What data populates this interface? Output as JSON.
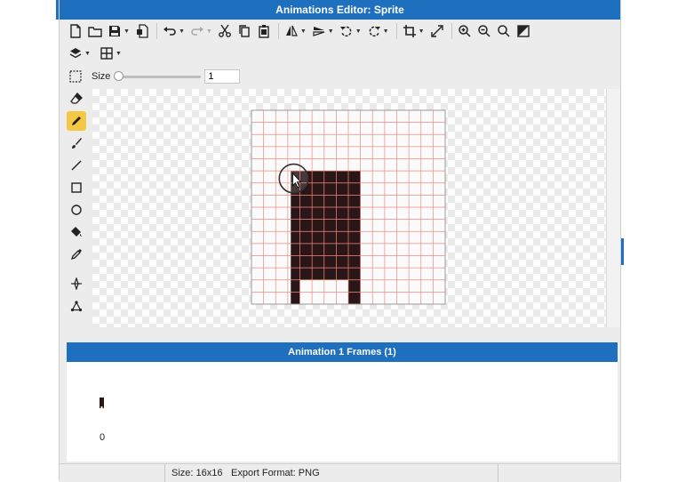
{
  "window": {
    "title": "Animations Editor: Sprite"
  },
  "toolbar": {
    "size_label": "Size",
    "size_value": "1",
    "size_slider_fraction": 0.0
  },
  "left_tools": [
    "eraser",
    "pencil",
    "brush",
    "line",
    "rectangle",
    "ellipse",
    "fill",
    "eyedropper",
    "pivot",
    "skeleton"
  ],
  "active_tool": "pencil",
  "canvas": {
    "grid_cols": 16,
    "grid_rows": 16
  },
  "frames": {
    "header": "Animation 1 Frames (1)",
    "items": [
      {
        "index": "0"
      }
    ]
  },
  "status": {
    "size": "Size: 16x16",
    "export_format": "Export Format: PNG"
  },
  "colors": {
    "accent": "#1f6fbf",
    "grid": "#f08a80",
    "pixel": "#2a1616",
    "active_tool": "#f4c842"
  }
}
